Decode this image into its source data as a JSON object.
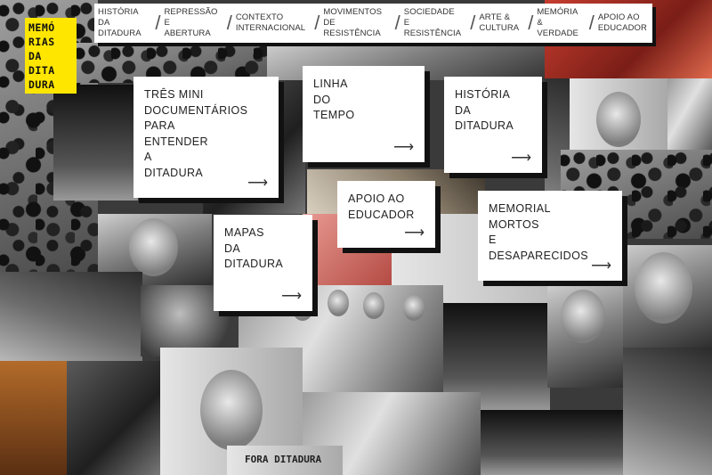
{
  "logo": {
    "lines": [
      "MEMÓ",
      "RIAS",
      "DA",
      "DITA",
      "DURA"
    ],
    "color": "#ffe600"
  },
  "nav": {
    "items": [
      {
        "label": "HISTÓRIA DA\nDITADURA"
      },
      {
        "label": "REPRESSÃO E\nABERTURA"
      },
      {
        "label": "CONTEXTO\nINTERNACIONAL"
      },
      {
        "label": "MOVIMENTOS\nDE RESISTÊNCIA"
      },
      {
        "label": "SOCIEDADE E\nRESISTÊNCIA"
      },
      {
        "label": "ARTE &\nCULTURA"
      },
      {
        "label": "MEMÓRIA\n& VERDADE"
      },
      {
        "label": "APOIO AO\nEDUCADOR"
      }
    ]
  },
  "cards": [
    {
      "title": "TRÊS MINI\nDOCUMENTÁRIOS\nPARA\nENTENDER\nA\nDITADURA"
    },
    {
      "title": "LINHA\nDO\nTEMPO"
    },
    {
      "title": "HISTÓRIA\nDA\nDITADURA"
    },
    {
      "title": "APOIO AO\nEDUCADOR"
    },
    {
      "title": "MAPAS\nDA\nDITADURA"
    },
    {
      "title": "MEMORIAL\nMORTOS\nE\nDESAPARECIDOS"
    }
  ],
  "arrow_glyph": "⟶",
  "banner": {
    "text": "FORA DITADURA"
  },
  "icons": [
    "arrow-right-icon"
  ]
}
